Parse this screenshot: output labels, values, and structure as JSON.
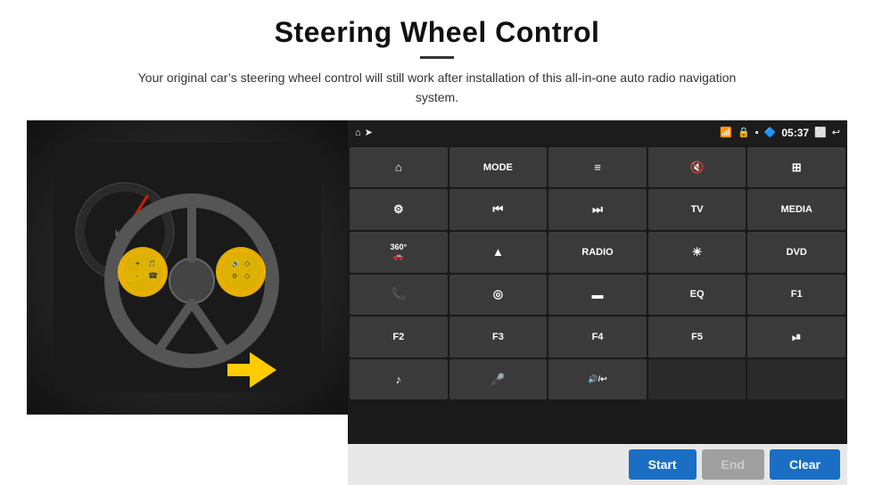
{
  "page": {
    "title": "Steering Wheel Control",
    "subtitle": "Your original car’s steering wheel control will still work after installation of this all-in-one auto radio navigation system."
  },
  "status_bar": {
    "time": "05:37",
    "icons": [
      "home",
      "wifi",
      "lock",
      "sim",
      "bluetooth",
      "screen",
      "back"
    ]
  },
  "button_grid": [
    [
      {
        "label": "⌂",
        "type": "icon"
      },
      {
        "label": "MODE",
        "type": "text"
      },
      {
        "label": "≡",
        "type": "icon"
      },
      {
        "label": "🔇",
        "type": "icon"
      },
      {
        "label": "⊞",
        "type": "icon"
      }
    ],
    [
      {
        "label": "⚙",
        "type": "icon"
      },
      {
        "label": "⏮",
        "type": "icon"
      },
      {
        "label": "⏭",
        "type": "icon"
      },
      {
        "label": "TV",
        "type": "text"
      },
      {
        "label": "MEDIA",
        "type": "text"
      }
    ],
    [
      {
        "label": "360°",
        "type": "text"
      },
      {
        "label": "▲",
        "type": "icon"
      },
      {
        "label": "RADIO",
        "type": "text"
      },
      {
        "label": "☀",
        "type": "icon"
      },
      {
        "label": "DVD",
        "type": "text"
      }
    ],
    [
      {
        "label": "📞",
        "type": "icon"
      },
      {
        "label": "◎",
        "type": "icon"
      },
      {
        "label": "▬",
        "type": "icon"
      },
      {
        "label": "EQ",
        "type": "text"
      },
      {
        "label": "F1",
        "type": "text"
      }
    ],
    [
      {
        "label": "F2",
        "type": "text"
      },
      {
        "label": "F3",
        "type": "text"
      },
      {
        "label": "F4",
        "type": "text"
      },
      {
        "label": "F5",
        "type": "text"
      },
      {
        "label": "⏯",
        "type": "icon"
      }
    ],
    [
      {
        "label": "♪",
        "type": "icon"
      },
      {
        "label": "🎤",
        "type": "icon"
      },
      {
        "label": "🔊/↩",
        "type": "icon"
      },
      {
        "label": "",
        "type": "empty"
      },
      {
        "label": "",
        "type": "empty"
      }
    ]
  ],
  "bottom_bar": {
    "start_label": "Start",
    "end_label": "End",
    "clear_label": "Clear"
  }
}
